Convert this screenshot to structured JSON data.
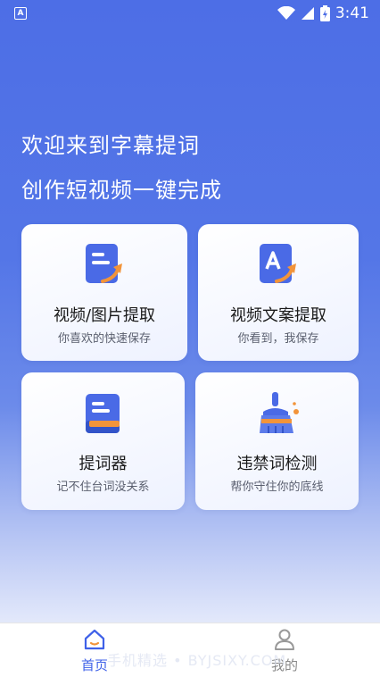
{
  "status_bar": {
    "time": "3:41",
    "app_icon_letter": "A"
  },
  "headline": {
    "line1": "欢迎来到字幕提词",
    "line2": "创作短视频一键完成"
  },
  "cards": [
    {
      "title": "视频/图片提取",
      "subtitle": "你喜欢的快速保存",
      "icon": "document-arrow-icon"
    },
    {
      "title": "视频文案提取",
      "subtitle": "你看到，我保存",
      "icon": "text-a-arrow-icon"
    },
    {
      "title": "提词器",
      "subtitle": "记不住台词没关系",
      "icon": "book-icon"
    },
    {
      "title": "违禁词检测",
      "subtitle": "帮你守住你的底线",
      "icon": "broom-icon"
    }
  ],
  "bottom_nav": [
    {
      "label": "首页",
      "icon": "home-icon",
      "active": true
    },
    {
      "label": "我的",
      "icon": "user-icon",
      "active": false
    }
  ],
  "watermark": "手机精选 • BYJSIXY.COM",
  "colors": {
    "accent": "#3f61e8",
    "orange": "#f2943a"
  }
}
